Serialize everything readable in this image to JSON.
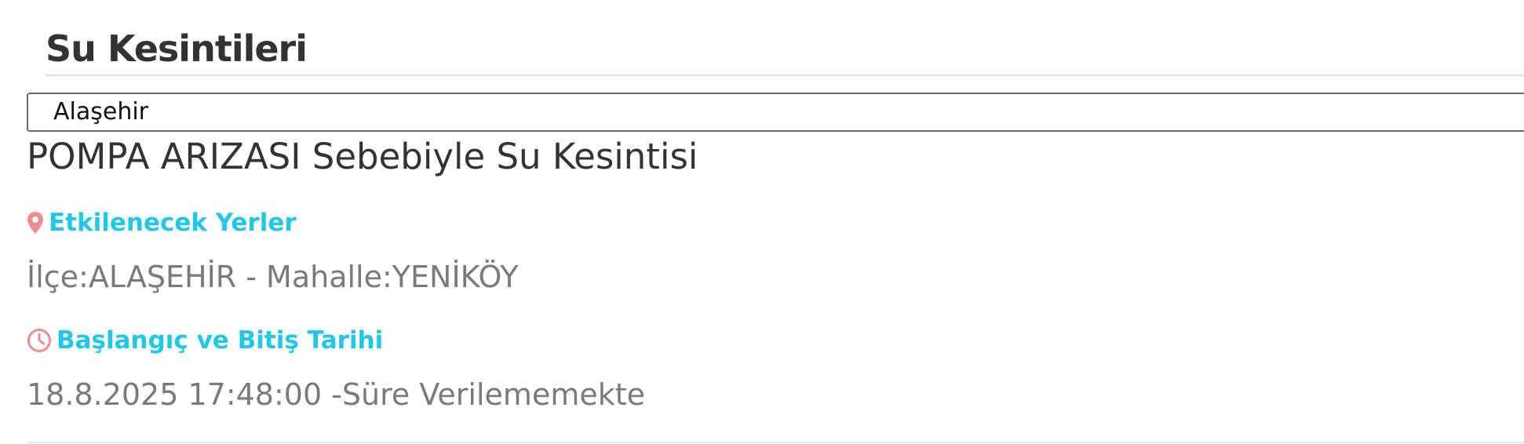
{
  "page": {
    "title": "Su Kesintileri"
  },
  "filter": {
    "district_selected": "Alaşehir"
  },
  "outage": {
    "title": "POMPA ARIZASI Sebebiyle Su Kesintisi",
    "places_heading": "Etkilenecek Yerler",
    "places_icon": "map-pin-icon",
    "places_value": "İlçe:ALAŞEHİR - Mahalle:YENİKÖY",
    "dates_heading": "Başlangıç ve Bitiş Tarihi",
    "dates_icon": "clock-icon",
    "dates_value": "18.8.2025 17:48:00 -Süre Verilememekte"
  },
  "colors": {
    "accent": "#1fc8e8",
    "icon": "#f28b8b",
    "title_text": "#333333",
    "body_text": "#7a7a7a"
  }
}
